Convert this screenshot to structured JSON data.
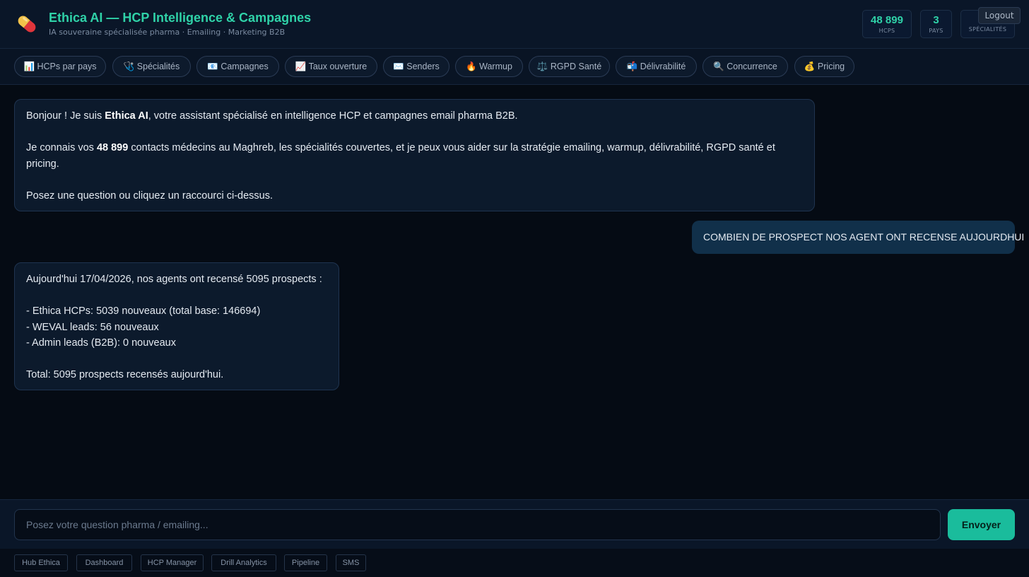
{
  "header": {
    "title": "Ethica AI — HCP Intelligence & Campagnes",
    "subtitle": "IA souveraine spécialisée pharma · Emailing · Marketing B2B",
    "logo_icon": "pill-icon",
    "stats": [
      {
        "value": "48 899",
        "label": "HCPS"
      },
      {
        "value": "3",
        "label": "PAYS"
      },
      {
        "value": "",
        "label": "SPÉCIALITÉS"
      }
    ],
    "logout_label": "Logout"
  },
  "shortcuts": [
    {
      "icon": "📊",
      "label": "HCPs par pays"
    },
    {
      "icon": "🩺",
      "label": "Spécialités"
    },
    {
      "icon": "📧",
      "label": "Campagnes"
    },
    {
      "icon": "📈",
      "label": "Taux ouverture"
    },
    {
      "icon": "✉️",
      "label": "Senders"
    },
    {
      "icon": "🔥",
      "label": "Warmup"
    },
    {
      "icon": "⚖️",
      "label": "RGPD Santé"
    },
    {
      "icon": "📬",
      "label": "Délivrabilité"
    },
    {
      "icon": "🔍",
      "label": "Concurrence"
    },
    {
      "icon": "💰",
      "label": "Pricing"
    }
  ],
  "messages": {
    "welcome": {
      "l1_pre": "Bonjour ! Je suis ",
      "l1_bold": "Ethica AI",
      "l1_post": ", votre assistant spécialisé en intelligence HCP et campagnes email pharma B2B.",
      "l2_pre": "Je connais vos ",
      "l2_bold": "48 899",
      "l2_post": " contacts médecins au Maghreb, les spécialités couvertes, et je peux vous aider sur la stratégie emailing, warmup, délivrabilité, RGPD santé et pricing.",
      "l3": "Posez une question ou cliquez un raccourci ci-dessus."
    },
    "user": "COMBIEN DE PROSPECT NOS AGENT ONT RECENSE AUJOURDHUI",
    "answer": {
      "l1": "Aujourd'hui 17/04/2026, nos agents ont recensé 5095 prospects :",
      "l2": "- Ethica HCPs: 5039 nouveaux (total base: 146694)",
      "l3": "- WEVAL leads: 56 nouveaux",
      "l4": "- Admin leads (B2B): 0 nouveaux",
      "l5": "Total: 5095 prospects recensés aujourd'hui."
    }
  },
  "input": {
    "placeholder": "Posez votre question pharma / emailing...",
    "value": "",
    "send_label": "Envoyer"
  },
  "footer_links": [
    "Hub Ethica",
    "Dashboard",
    "HCP Manager",
    "Drill Analytics",
    "Pipeline",
    "SMS"
  ],
  "colors": {
    "accent": "#2fd2a8",
    "send_button": "#1abc9c",
    "background": "#050b14",
    "bubble": "#0c1a2c",
    "user_bubble": "#11304a"
  }
}
